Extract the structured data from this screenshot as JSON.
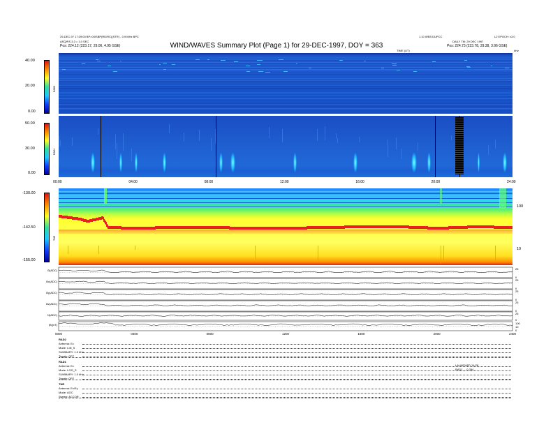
{
  "header": {
    "title": "WIND/WAVES Summary Plot (Page 1) for 29-DEC-1997, DOY = 363",
    "meta_left_1": "29-DEC-97 17:29:00 BP=0/0SBP(RD/RC)(STR) - 0.9 MHz BPC",
    "meta_left_2": "ASQ/RS 3.3 = 1.0 SEC",
    "pos_left": "Pos: 224.12 (223.17, 29.06, 4.95 GSE)",
    "meta_right_1": "1.10 WEB DUPCC",
    "meta_right_2": "L2 EPOCH: v3.0",
    "meta_right_3": "DAILY TM: 29 DEC 1997",
    "pos_right": "Pos: 224.73 (223.78, 29.38, 3.96 GSE)",
    "time_label": "TIME (UT)",
    "khz_label": "kHz"
  },
  "chart_data": [
    {
      "type": "heatmap",
      "name": "RAD2",
      "ylabel": "RAD2",
      "colorbar_ticks": [
        "40.00",
        "20.00",
        "0.00"
      ],
      "colorbar_range": [
        0,
        40
      ],
      "xlim": [
        0,
        24
      ],
      "background": "#1f5fd0"
    },
    {
      "type": "heatmap",
      "name": "RAD1",
      "ylabel": "RAD1",
      "colorbar_ticks": [
        "50.00",
        "30.00",
        "0.00"
      ],
      "colorbar_range": [
        0,
        50
      ],
      "xlim": [
        0,
        24
      ],
      "x_tick_labels": [
        "00:00",
        "04:00",
        "08:00",
        "12:00",
        "16:00",
        "20:00",
        "24:00"
      ],
      "vertical_markers_hours": [
        2.2,
        8.3,
        19.9,
        21.2
      ],
      "background": "#1f5fd0"
    },
    {
      "type": "heatmap",
      "name": "TNR",
      "ylabel": "TNR",
      "colorbar_ticks": [
        "-130.00",
        "-142.50",
        "-155.00"
      ],
      "colorbar_range": [
        -155,
        -130
      ],
      "right_axis_ticks": [
        "100",
        "10"
      ],
      "xlim": [
        0,
        24
      ],
      "x_tick_labels": [
        "00:00",
        "04:00",
        "08:00",
        "12:00",
        "16:00",
        "20:00",
        "24:00"
      ]
    },
    {
      "type": "line",
      "name": "Magnetometer",
      "xlim": [
        0,
        24
      ],
      "x_tick_labels": [
        "0000",
        "0400",
        "0800",
        "1200",
        "1600",
        "2000",
        "2400"
      ],
      "series": [
        {
          "name": "B(ADC)",
          "right_ticks": [
            "25",
            "0"
          ]
        },
        {
          "name": "Bx(ADC)",
          "right_ticks": [
            "25",
            "0"
          ]
        },
        {
          "name": "By(ADC)",
          "right_ticks": [
            "25",
            "0"
          ]
        },
        {
          "name": "Bz(ADC)",
          "right_ticks": [
            "25",
            "0"
          ]
        },
        {
          "name": "N(ADC)",
          "right_ticks": [
            "25",
            "0"
          ]
        },
        {
          "name": "|B|(nT)",
          "right_ticks": [
            "100",
            "10",
            "0"
          ]
        }
      ]
    }
  ],
  "footer": {
    "blocks": [
      {
        "name": "RAD2",
        "lines": [
          "Antenna: Ex",
          "Mode: LIN_S",
          "SUMMARY: 1.0 kHz",
          "Toggle: OFF"
        ]
      },
      {
        "name": "RAD1",
        "lines": [
          "Antenna: Ex",
          "Mode: LOG_S",
          "SUMMARY: 1.0 kHz",
          "Toggle: OFF"
        ]
      },
      {
        "name": "TNR",
        "lines": [
          "Antenna: Ex/Ey",
          "Mode: AGC",
          "Sweep: ACCOR"
        ]
      }
    ],
    "right_note_1": "LAUNCHED 14:28",
    "right_note_2": "RAD1 ... 0.284 ..."
  },
  "colors": {
    "rainbow": [
      "#e01010",
      "#ff8c00",
      "#ffff20",
      "#30e0a0",
      "#20c8ff",
      "#1040ff",
      "#0000a0"
    ],
    "radio_background": "#1f5fd0",
    "tnr_band": "#e02020"
  }
}
